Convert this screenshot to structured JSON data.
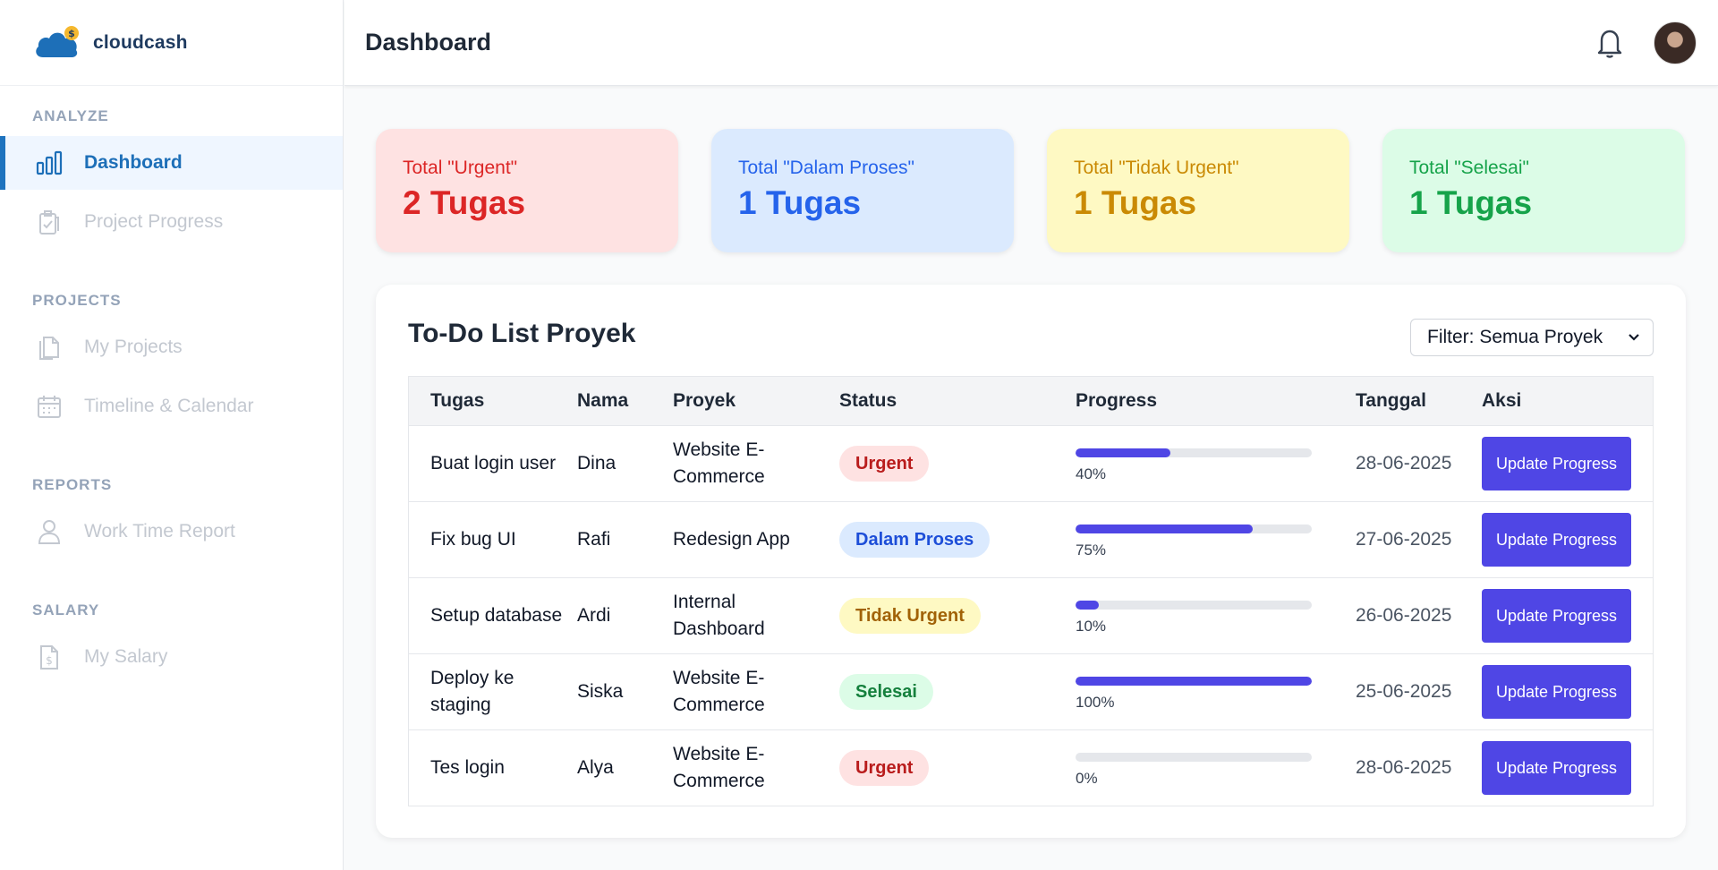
{
  "app": {
    "name": "cloudcash"
  },
  "header": {
    "title": "Dashboard"
  },
  "sidebar": {
    "sections": [
      {
        "title": "ANALYZE",
        "items": [
          {
            "label": "Dashboard",
            "icon": "bar-chart-icon",
            "active": true
          },
          {
            "label": "Project Progress",
            "icon": "clipboard-check-icon"
          }
        ]
      },
      {
        "title": "PROJECTS",
        "items": [
          {
            "label": "My Projects",
            "icon": "documents-icon"
          },
          {
            "label": "Timeline & Calendar",
            "icon": "calendar-icon"
          }
        ]
      },
      {
        "title": "REPORTS",
        "items": [
          {
            "label": "Work Time Report",
            "icon": "user-icon"
          }
        ]
      },
      {
        "title": "SALARY",
        "items": [
          {
            "label": "My Salary",
            "icon": "dollar-file-icon"
          }
        ]
      }
    ]
  },
  "cards": [
    {
      "label": "Total \"Urgent\"",
      "value": "2 Tugas",
      "color": "#dc2626",
      "bg": "#fee2e2"
    },
    {
      "label": "Total \"Dalam Proses\"",
      "value": "1 Tugas",
      "color": "#2563eb",
      "bg": "#dbeafe"
    },
    {
      "label": "Total \"Tidak Urgent\"",
      "value": "1 Tugas",
      "color": "#ca8a04",
      "bg": "#fef9c3"
    },
    {
      "label": "Total \"Selesai\"",
      "value": "1 Tugas",
      "color": "#16a34a",
      "bg": "#dcfce7"
    }
  ],
  "todo": {
    "title": "To-Do List Proyek",
    "filter": {
      "selected": "Filter: Semua Proyek"
    },
    "columns": [
      "Tugas",
      "Nama",
      "Proyek",
      "Status",
      "Progress",
      "Tanggal",
      "Aksi"
    ],
    "rows": [
      {
        "task": "Buat login user",
        "name": "Dina",
        "project": "Website E-Commerce",
        "status": "Urgent",
        "progress": 40,
        "progress_label": "40%",
        "date": "28-06-2025",
        "action": "Update Progress"
      },
      {
        "task": "Fix bug UI",
        "name": "Rafi",
        "project": "Redesign App",
        "status": "Dalam Proses",
        "progress": 75,
        "progress_label": "75%",
        "date": "27-06-2025",
        "action": "Update Progress"
      },
      {
        "task": "Setup database",
        "name": "Ardi",
        "project": "Internal Dashboard",
        "status": "Tidak Urgent",
        "progress": 10,
        "progress_label": "10%",
        "date": "26-06-2025",
        "action": "Update Progress"
      },
      {
        "task": "Deploy ke staging",
        "name": "Siska",
        "project": "Website E-Commerce",
        "status": "Selesai",
        "progress": 100,
        "progress_label": "100%",
        "date": "25-06-2025",
        "action": "Update Progress"
      },
      {
        "task": "Tes login",
        "name": "Alya",
        "project": "Website E-Commerce",
        "status": "Urgent",
        "progress": 0,
        "progress_label": "0%",
        "date": "28-06-2025",
        "action": "Update Progress"
      }
    ]
  },
  "colors": {
    "accent": "#4f46e5",
    "brand": "#1e73be"
  }
}
